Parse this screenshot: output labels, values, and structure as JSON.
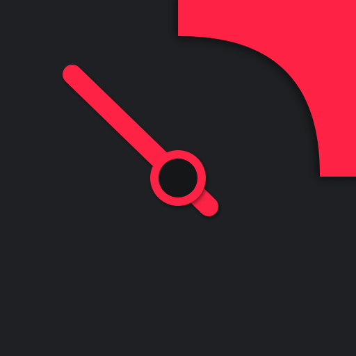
{
  "app_icon": {
    "icon": "clock-icon",
    "colors": {
      "background": "#1f2023",
      "accent": "#fe2445",
      "hand_secondary": "#9a9a9a",
      "hub_center": "#151618"
    }
  }
}
